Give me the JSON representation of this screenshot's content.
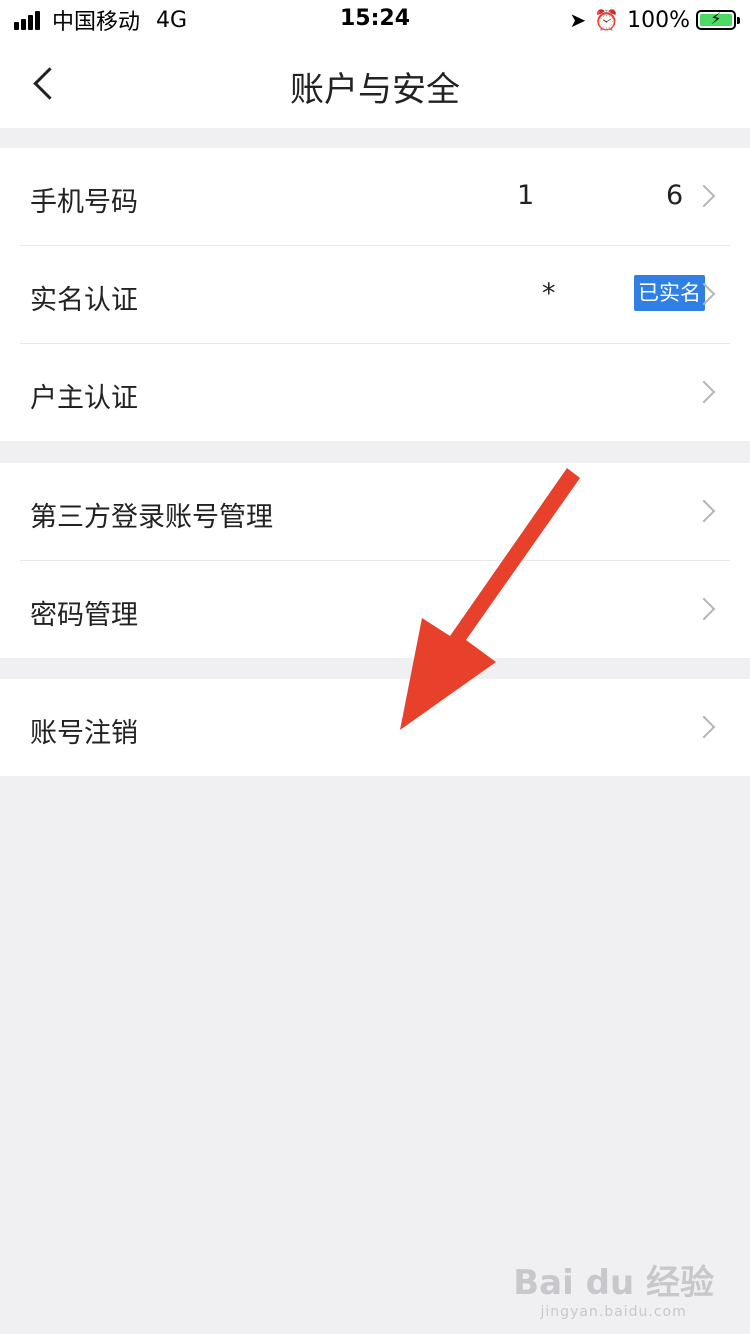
{
  "status_bar": {
    "carrier": "中国移动",
    "network": "4G",
    "time": "15:24",
    "battery": "100%",
    "icons": [
      "signal-icon",
      "location-icon",
      "alarm-icon",
      "battery-charging-icon"
    ]
  },
  "nav": {
    "title": "账户与安全",
    "back_icon": "chevron-left-icon"
  },
  "groups": [
    {
      "items": [
        {
          "label": "手机号码",
          "value_start": "1",
          "value_end": "6"
        },
        {
          "label": "实名认证",
          "value": "*",
          "badge": "已实名"
        },
        {
          "label": "户主认证"
        }
      ]
    },
    {
      "items": [
        {
          "label": "第三方登录账号管理"
        },
        {
          "label": "密码管理"
        }
      ]
    },
    {
      "items": [
        {
          "label": "账号注销"
        }
      ]
    }
  ],
  "annotation": {
    "color": "#e8412b",
    "icon": "red-arrow-annotation"
  },
  "watermark": {
    "main": "Bai du 经验",
    "sub": "jingyan.baidu.com"
  },
  "colors": {
    "badge": "#2f7fe5",
    "background": "#f0f0f2",
    "battery": "#4cd964"
  }
}
